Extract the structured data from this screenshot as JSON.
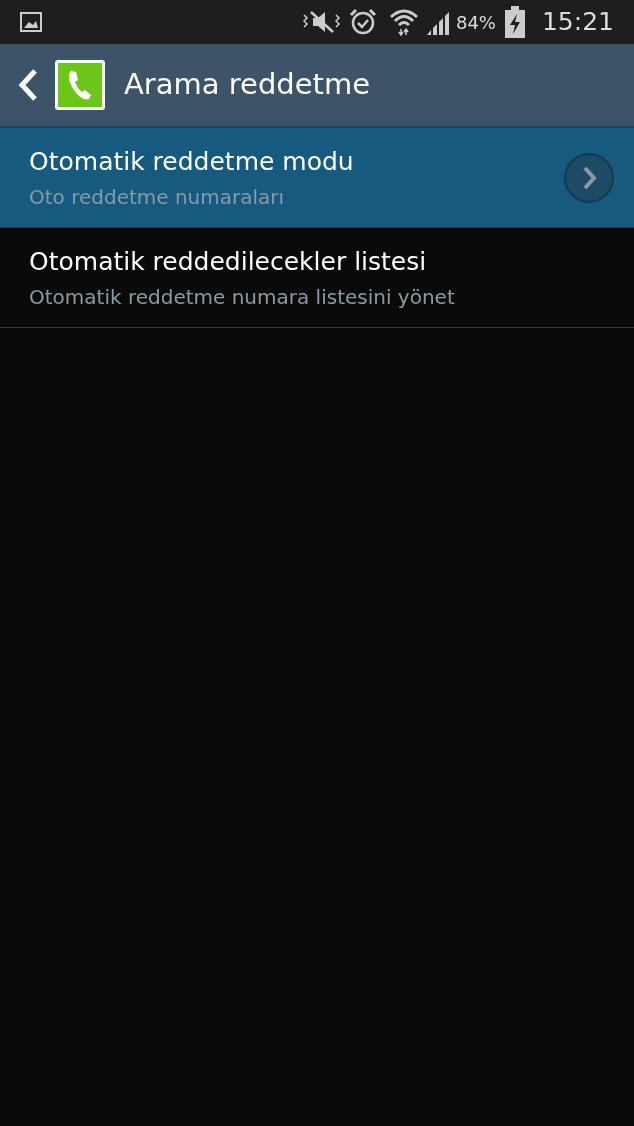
{
  "status_bar": {
    "battery": "84%",
    "time": "15:21"
  },
  "action_bar": {
    "title": "Arama reddetme"
  },
  "items": [
    {
      "title": "Otomatik reddetme modu",
      "subtitle": "Oto reddetme numaraları",
      "selected": true,
      "arrow": true
    },
    {
      "title": "Otomatik reddedilecekler listesi",
      "subtitle": "Otomatik reddetme numara listesini yönet",
      "selected": false,
      "arrow": false
    }
  ]
}
